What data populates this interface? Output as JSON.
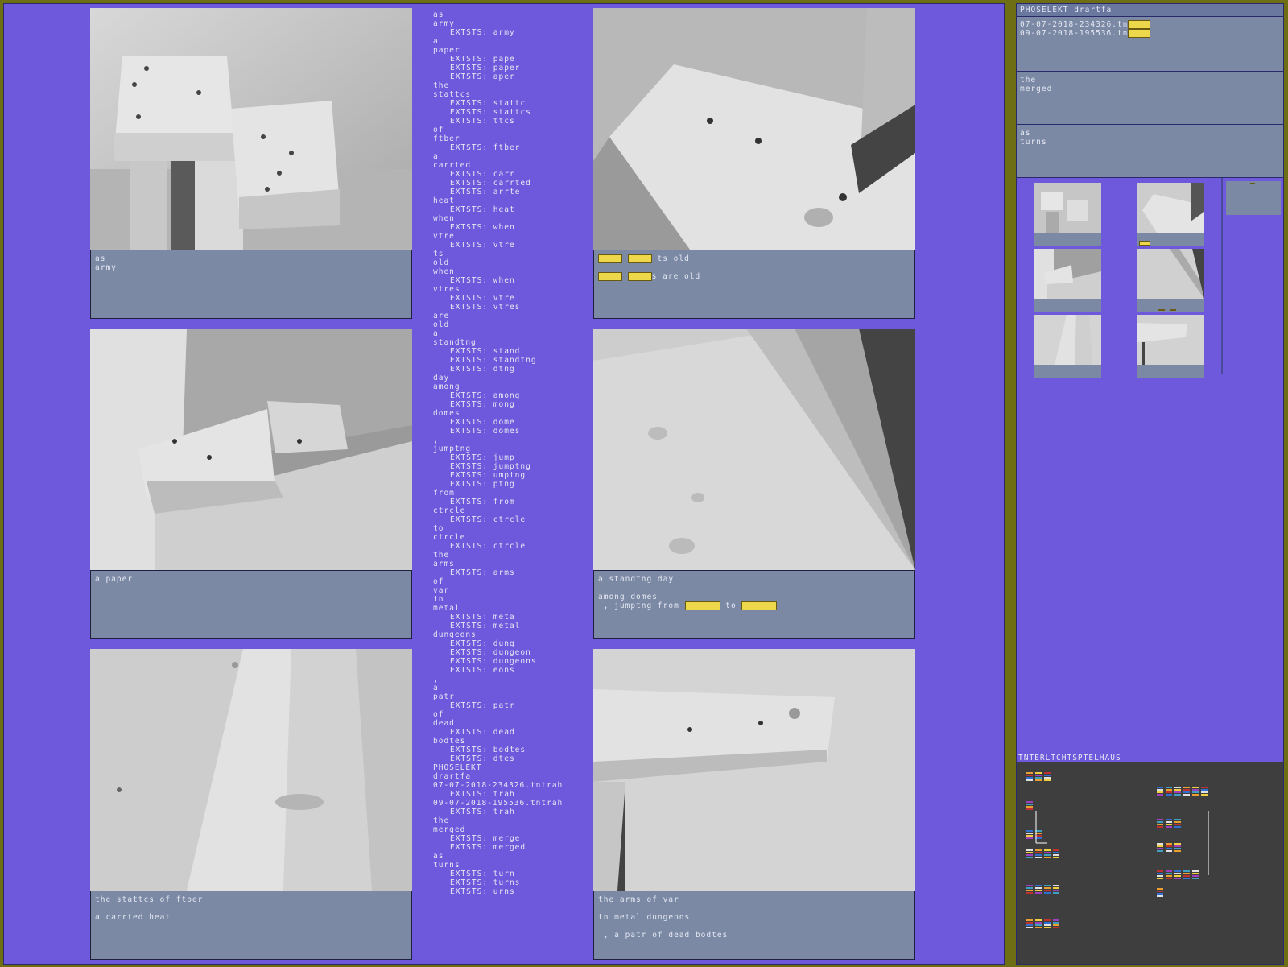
{
  "cards": [
    {
      "id": "c1",
      "caption": "as\narmy"
    },
    {
      "id": "c2",
      "caption_parts": [
        "ts old",
        "s are old"
      ]
    },
    {
      "id": "c3",
      "caption": "a paper"
    },
    {
      "id": "c4",
      "caption_line1": "a standtng day",
      "caption_line2": "among domes",
      "caption_line3a": " , jumptng from ",
      "caption_line3b": "to"
    },
    {
      "id": "c5",
      "caption": "the stattcs of ftber\n\na carrted heat"
    },
    {
      "id": "c6",
      "caption": "the arms of var\n\ntn metal dungeons\n\n , a patr of dead bodtes"
    }
  ],
  "wordlist": [
    {
      "w": "as"
    },
    {
      "w": "army",
      "ex": [
        "army"
      ]
    },
    {
      "w": "a"
    },
    {
      "w": "paper",
      "ex": [
        "pape",
        "paper",
        "aper"
      ]
    },
    {
      "w": "the"
    },
    {
      "w": "stattcs",
      "ex": [
        "stattc",
        "stattcs",
        "ttcs"
      ]
    },
    {
      "w": "of"
    },
    {
      "w": "ftber",
      "ex": [
        "ftber"
      ]
    },
    {
      "w": "a"
    },
    {
      "w": "carrted",
      "ex": [
        "carr",
        "carrted",
        "arrte"
      ]
    },
    {
      "w": "heat",
      "ex": [
        "heat"
      ]
    },
    {
      "w": "when",
      "ex": [
        "when"
      ]
    },
    {
      "w": "vtre",
      "ex": [
        "vtre"
      ]
    },
    {
      "w": "ts"
    },
    {
      "w": "old"
    },
    {
      "w": "when",
      "ex": [
        "when"
      ]
    },
    {
      "w": "vtres",
      "ex": [
        "vtre",
        "vtres"
      ]
    },
    {
      "w": "are"
    },
    {
      "w": "old"
    },
    {
      "w": "a"
    },
    {
      "w": "standtng",
      "ex": [
        "stand",
        "standtng",
        "dtng"
      ]
    },
    {
      "w": "day"
    },
    {
      "w": "among",
      "ex": [
        "among",
        "mong"
      ]
    },
    {
      "w": "domes",
      "ex": [
        "dome",
        "domes"
      ]
    },
    {
      "w": ","
    },
    {
      "w": "jumptng",
      "ex": [
        "jump",
        "jumptng",
        "umptng",
        "ptng"
      ]
    },
    {
      "w": "from",
      "ex": [
        "from"
      ]
    },
    {
      "w": "ctrcle",
      "ex": [
        "ctrcle"
      ]
    },
    {
      "w": "to"
    },
    {
      "w": "ctrcle",
      "ex": [
        "ctrcle"
      ]
    },
    {
      "w": "the"
    },
    {
      "w": "arms",
      "ex": [
        "arms"
      ]
    },
    {
      "w": "of"
    },
    {
      "w": "var"
    },
    {
      "w": "tn"
    },
    {
      "w": "metal",
      "ex": [
        "meta",
        "metal"
      ]
    },
    {
      "w": "dungeons",
      "ex": [
        "dung",
        "dungeon",
        "dungeons",
        "eons"
      ]
    },
    {
      "w": ","
    },
    {
      "w": "a"
    },
    {
      "w": "patr",
      "ex": [
        "patr"
      ]
    },
    {
      "w": "of"
    },
    {
      "w": "dead",
      "ex": [
        "dead"
      ]
    },
    {
      "w": "bodtes",
      "ex": [
        "bodtes",
        "dtes"
      ]
    },
    {
      "w": "PHOSELEKT"
    },
    {
      "w": "drartfa"
    },
    {
      "w": "07-07-2018-234326.tntrah",
      "ex": [
        "trah"
      ]
    },
    {
      "w": "09-07-2018-195536.tntrah",
      "ex": [
        "trah"
      ]
    },
    {
      "w": "the"
    },
    {
      "w": "merged",
      "ex": [
        "merge",
        "merged"
      ]
    },
    {
      "w": "as"
    },
    {
      "w": "turns",
      "ex": [
        "turn",
        "turns",
        "urns"
      ]
    }
  ],
  "extsts_label": "EXTSTS:",
  "right": {
    "title": "PHOSELEKT drartfa",
    "files": [
      "07-07-2018-234326.tn",
      "09-07-2018-195536.tn"
    ],
    "panel2": "the\nmerged",
    "panel3": "as\nturns",
    "inter_title": "TNTERLTCHTSPTELHAUS"
  }
}
